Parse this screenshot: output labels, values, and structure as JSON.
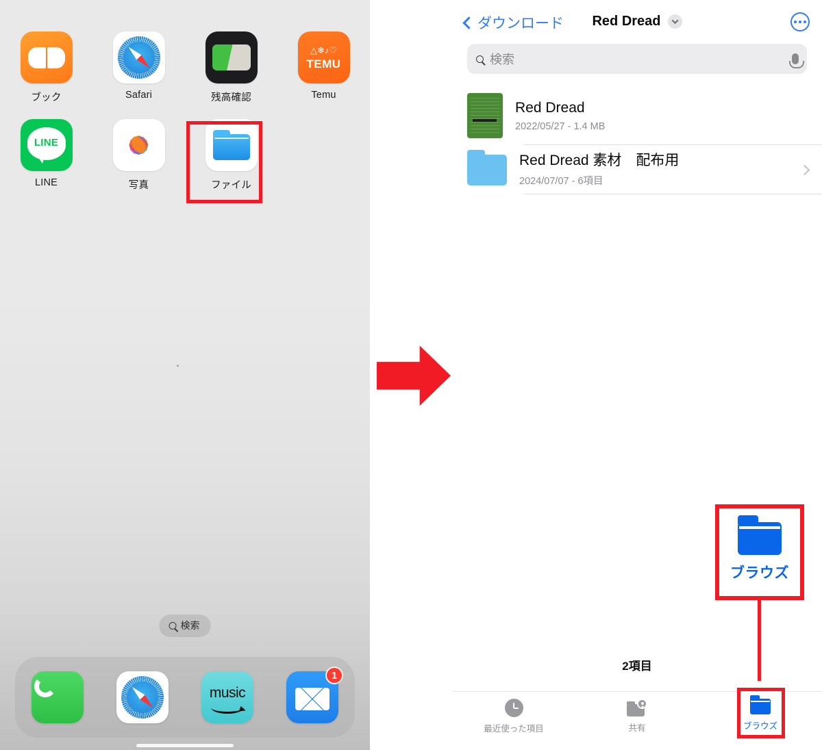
{
  "home_screen": {
    "apps": [
      {
        "label": "ブック",
        "icon": "books-icon"
      },
      {
        "label": "Safari",
        "icon": "safari-icon"
      },
      {
        "label": "残高確認",
        "icon": "balance-check-icon"
      },
      {
        "label": "Temu",
        "icon": "temu-icon",
        "wordmark": "TEMU"
      },
      {
        "label": "LINE",
        "icon": "line-icon",
        "wordmark": "LINE"
      },
      {
        "label": "写真",
        "icon": "photos-icon"
      },
      {
        "label": "ファイル",
        "icon": "files-icon"
      }
    ],
    "search_pill": "検索",
    "dock": [
      {
        "label": "電話",
        "icon": "phone-icon"
      },
      {
        "label": "Safari",
        "icon": "safari-icon"
      },
      {
        "label": "Amazon Music",
        "icon": "music-icon",
        "wordmark": "music"
      },
      {
        "label": "メール",
        "icon": "mail-icon",
        "badge": "1"
      }
    ]
  },
  "files_app": {
    "nav": {
      "back_label": "ダウンロード",
      "back_icon": "chevron-left-icon",
      "title": "Red Dread",
      "title_chevron_icon": "chevron-down-icon",
      "more_icon": "ellipsis-circle-icon"
    },
    "search": {
      "placeholder": "検索",
      "search_icon": "search-icon",
      "mic_icon": "microphone-icon"
    },
    "items": [
      {
        "name": "Red Dread",
        "meta": "2022/05/27 - 1.4 MB",
        "icon": "document-thumbnail",
        "has_chevron": false
      },
      {
        "name": "Red Dread 素材　配布用",
        "meta": "2024/07/07 - 6項目",
        "icon": "folder-icon",
        "has_chevron": true
      }
    ],
    "item_count": "2項目",
    "tabs": [
      {
        "label": "最近使った項目",
        "icon": "clock-icon",
        "active": false
      },
      {
        "label": "共有",
        "icon": "shared-folder-icon",
        "active": false
      },
      {
        "label": "ブラウズ",
        "icon": "browse-folder-icon",
        "active": true
      }
    ]
  },
  "annotations": {
    "arrow_icon": "red-right-arrow",
    "callout": {
      "icon": "browse-folder-icon",
      "label": "ブラウズ"
    },
    "highlight_color": "#f01b24"
  }
}
